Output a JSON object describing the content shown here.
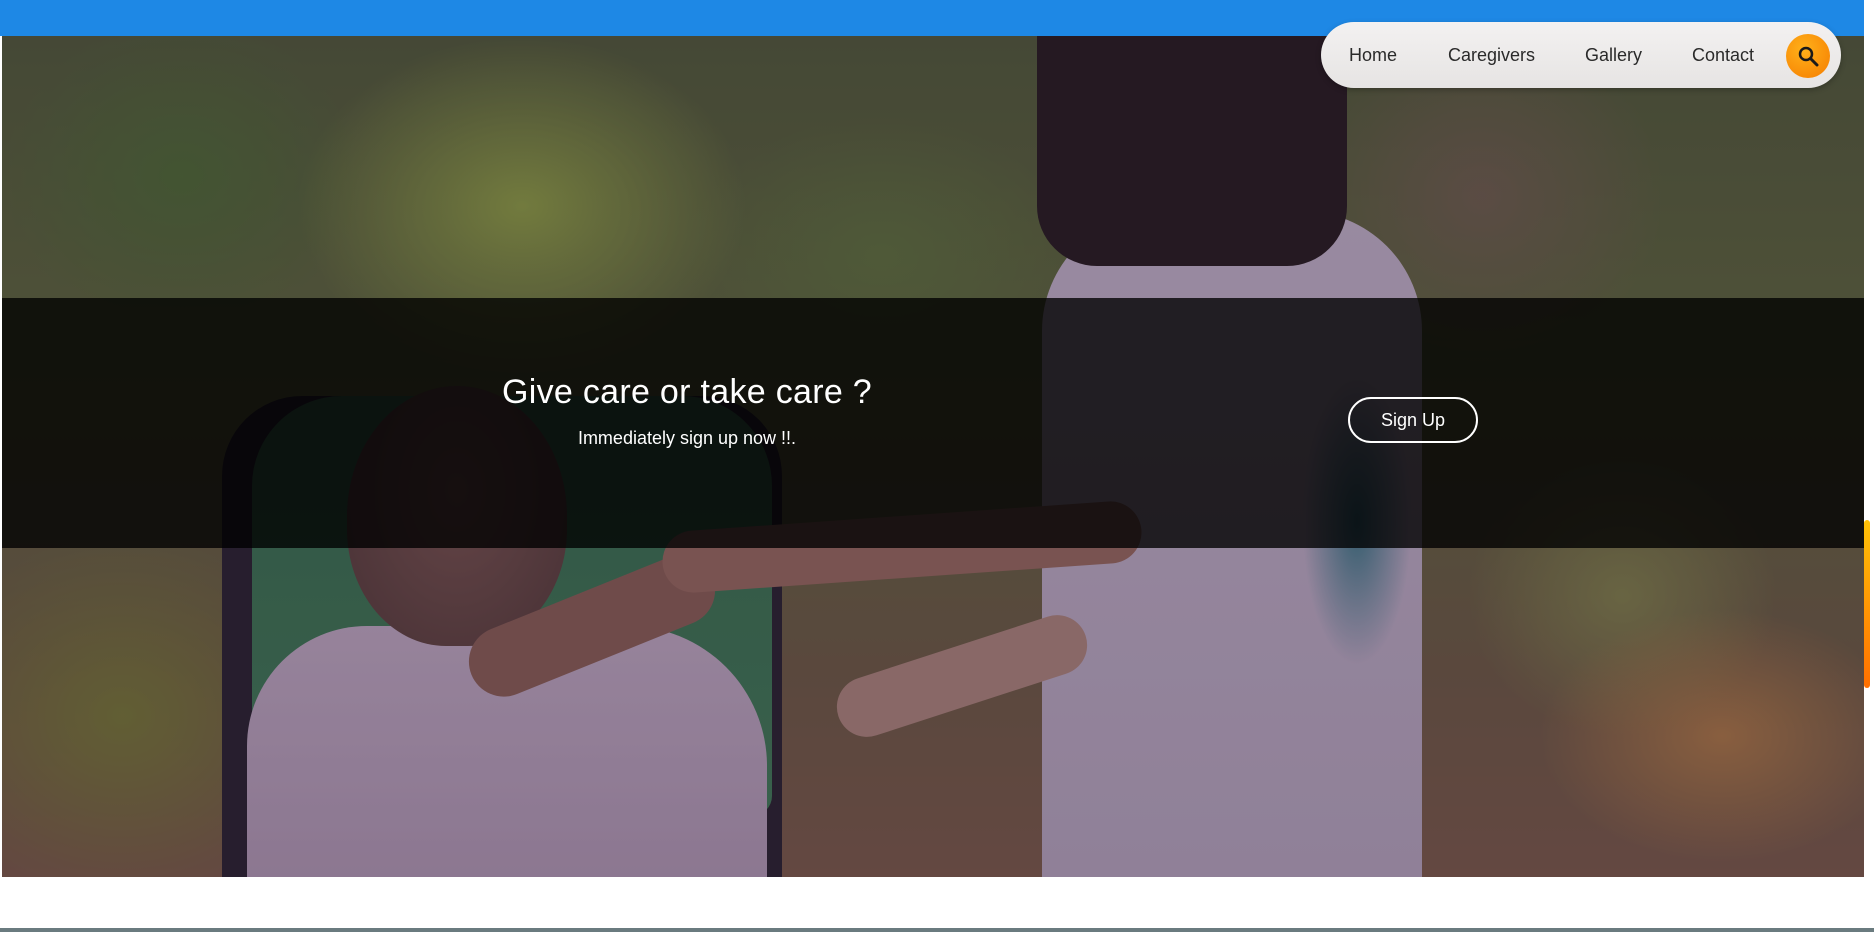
{
  "nav": {
    "items": [
      {
        "label": "Home"
      },
      {
        "label": "Caregivers"
      },
      {
        "label": "Gallery"
      },
      {
        "label": "Contact"
      }
    ],
    "search_icon": "search-icon"
  },
  "hero": {
    "title": "Give care or take care ?",
    "subtitle": "Immediately sign up now !!.",
    "signup_label": "Sign Up"
  },
  "colors": {
    "top_bar": "#1e88e5",
    "search_button": "#f57c00",
    "band": "rgba(0,0,0,0.78)"
  }
}
